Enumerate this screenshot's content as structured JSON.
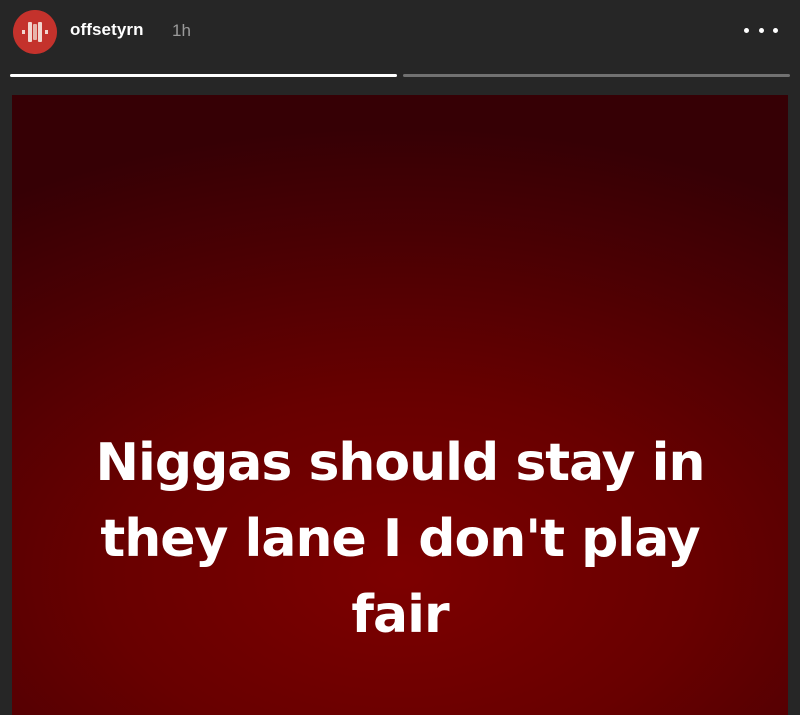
{
  "header": {
    "username": "offsetyrn",
    "time": "1h",
    "avatar_icon": "skull-logo-icon",
    "more_icon": "more-options-icon"
  },
  "progress": {
    "segments": [
      1.0,
      0.0
    ]
  },
  "story": {
    "lines": [
      "Niggas should stay in",
      "they lane I don't play",
      "fair"
    ],
    "background_color": "#6e0000",
    "text_color": "#ffffff"
  }
}
